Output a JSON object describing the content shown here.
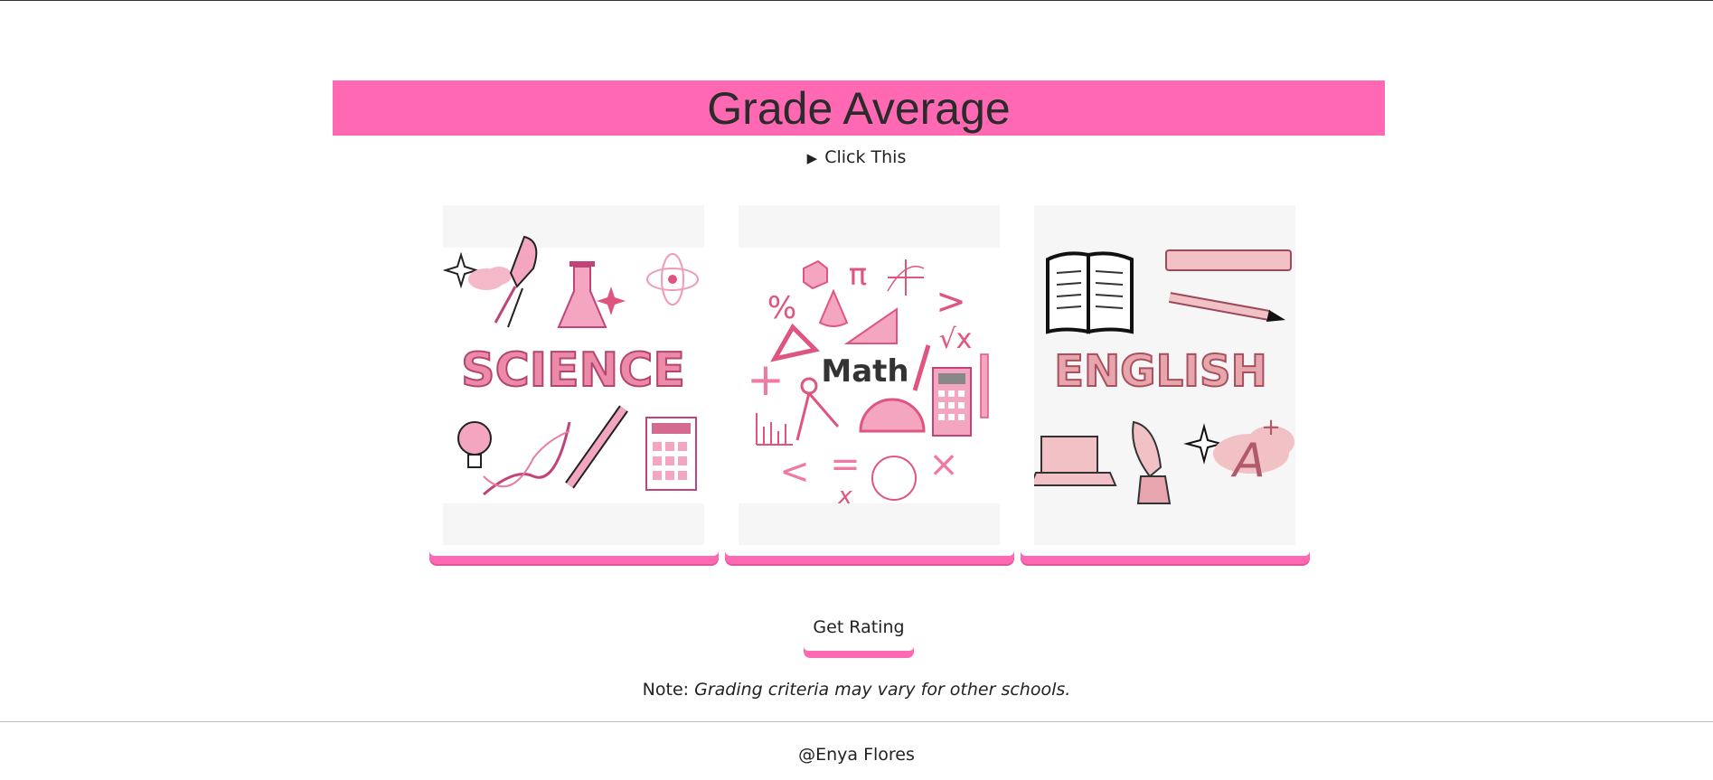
{
  "page": {
    "title": "Grade Average",
    "details_summary": "Click This",
    "cards": [
      {
        "word": "SCIENCE"
      },
      {
        "word": "Math"
      },
      {
        "word": "ENGLISH"
      }
    ],
    "rating_button": "Get Rating",
    "note_label": "Note:",
    "note_text": "Grading criteria may vary for other schools.",
    "footer": "@Enya Flores"
  },
  "colors": {
    "accent": "#ff69b4",
    "title_text": "#2b2b2b"
  },
  "icons": {
    "details": "disclosure-triangle-icon"
  }
}
